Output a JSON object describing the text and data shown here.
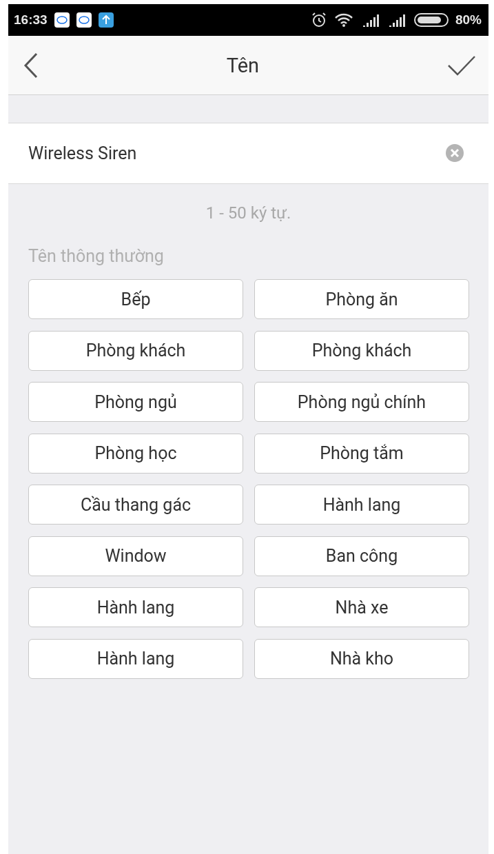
{
  "status_bar": {
    "time": "16:33",
    "battery": "80%"
  },
  "header": {
    "title": "Tên"
  },
  "name_field": {
    "value": "Wireless Siren"
  },
  "hint": "1 - 50 ký tự.",
  "section_label": "Tên thông thường",
  "suggestions": [
    "Bếp",
    "Phòng ăn",
    "Phòng khách",
    "Phòng khách",
    "Phòng ngủ",
    "Phòng ngủ chính",
    "Phòng học",
    "Phòng tắm",
    "Cầu thang gác",
    "Hành lang",
    "Window",
    "Ban công",
    "Hành lang",
    "Nhà xe",
    "Hành lang",
    "Nhà kho"
  ]
}
